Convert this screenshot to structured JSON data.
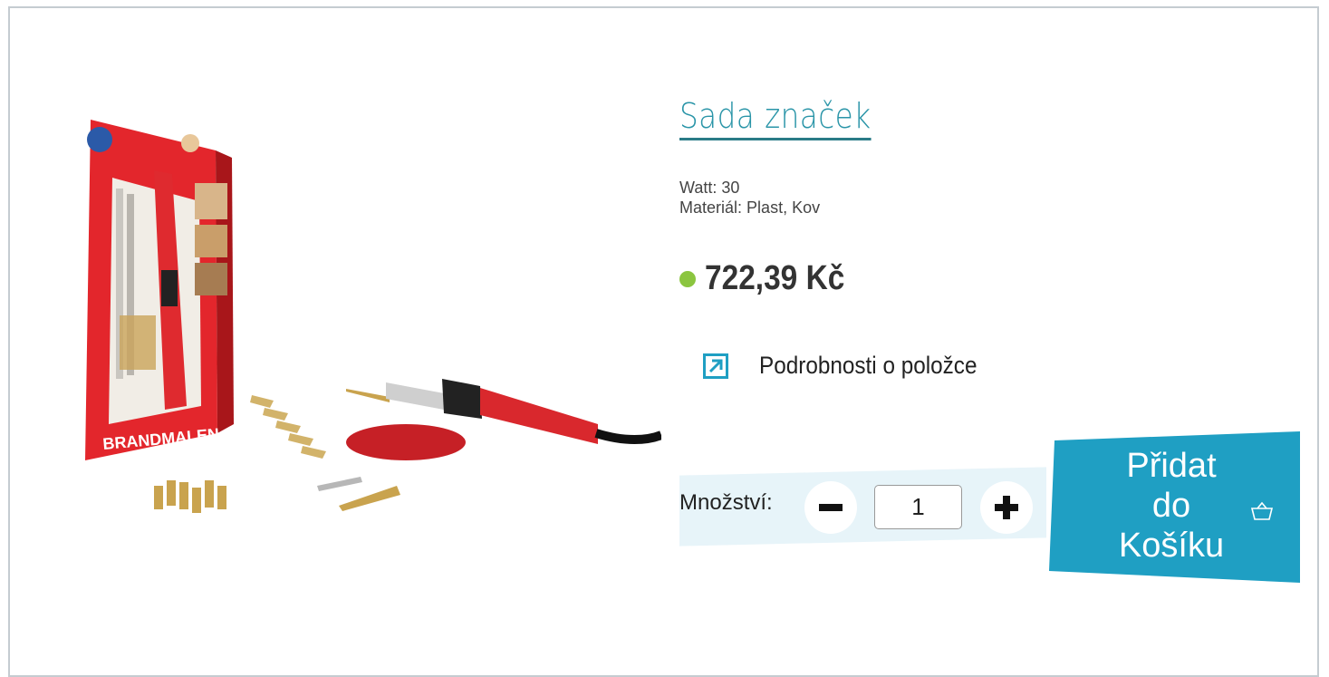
{
  "product": {
    "title": "Sada značek",
    "image_alt": "Pyrography tool set with red handle and brass tips",
    "box_label": "BRANDMALEN",
    "attributes": [
      {
        "key": "Watt:",
        "value": "30"
      },
      {
        "key": "Materiál:",
        "value": "Plast, Kov"
      }
    ],
    "price": "722,39 Kč"
  },
  "details_link": {
    "label": "Podrobnosti o položce",
    "icon": "external-arrow-icon"
  },
  "quantity": {
    "label": "Množství:",
    "value": "1",
    "minus_icon": "minus-icon",
    "plus_icon": "plus-icon"
  },
  "add_to_cart": {
    "label": "Přidat\ndo\nKošíku",
    "icon": "basket-icon"
  },
  "colors": {
    "accent": "#2a95a8",
    "button_bg": "#1f9fc3",
    "availability_dot": "#8bc53f",
    "quantity_strip": "#e7f4f9",
    "border": "#c5ccd1"
  }
}
